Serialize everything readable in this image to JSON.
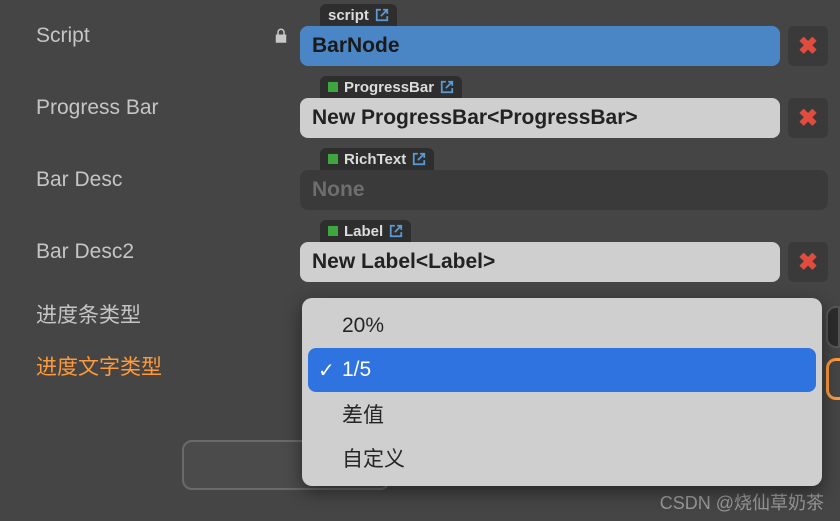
{
  "rows": {
    "script": {
      "label": "Script",
      "tag": "script",
      "value": "BarNode"
    },
    "progressBar": {
      "label": "Progress Bar",
      "tag": "ProgressBar",
      "value": "New ProgressBar<ProgressBar>"
    },
    "barDesc": {
      "label": "Bar Desc",
      "tag": "RichText",
      "value": "None"
    },
    "barDesc2": {
      "label": "Bar Desc2",
      "tag": "Label",
      "value": "New Label<Label>"
    },
    "progressType": {
      "label": "进度条类型"
    },
    "textType": {
      "label": "进度文字类型"
    }
  },
  "dropdown": {
    "options": [
      {
        "label": "20%"
      },
      {
        "label": "1/5",
        "selected": true
      },
      {
        "label": "差值"
      },
      {
        "label": "自定义"
      }
    ]
  },
  "watermark": "CSDN @烧仙草奶茶"
}
